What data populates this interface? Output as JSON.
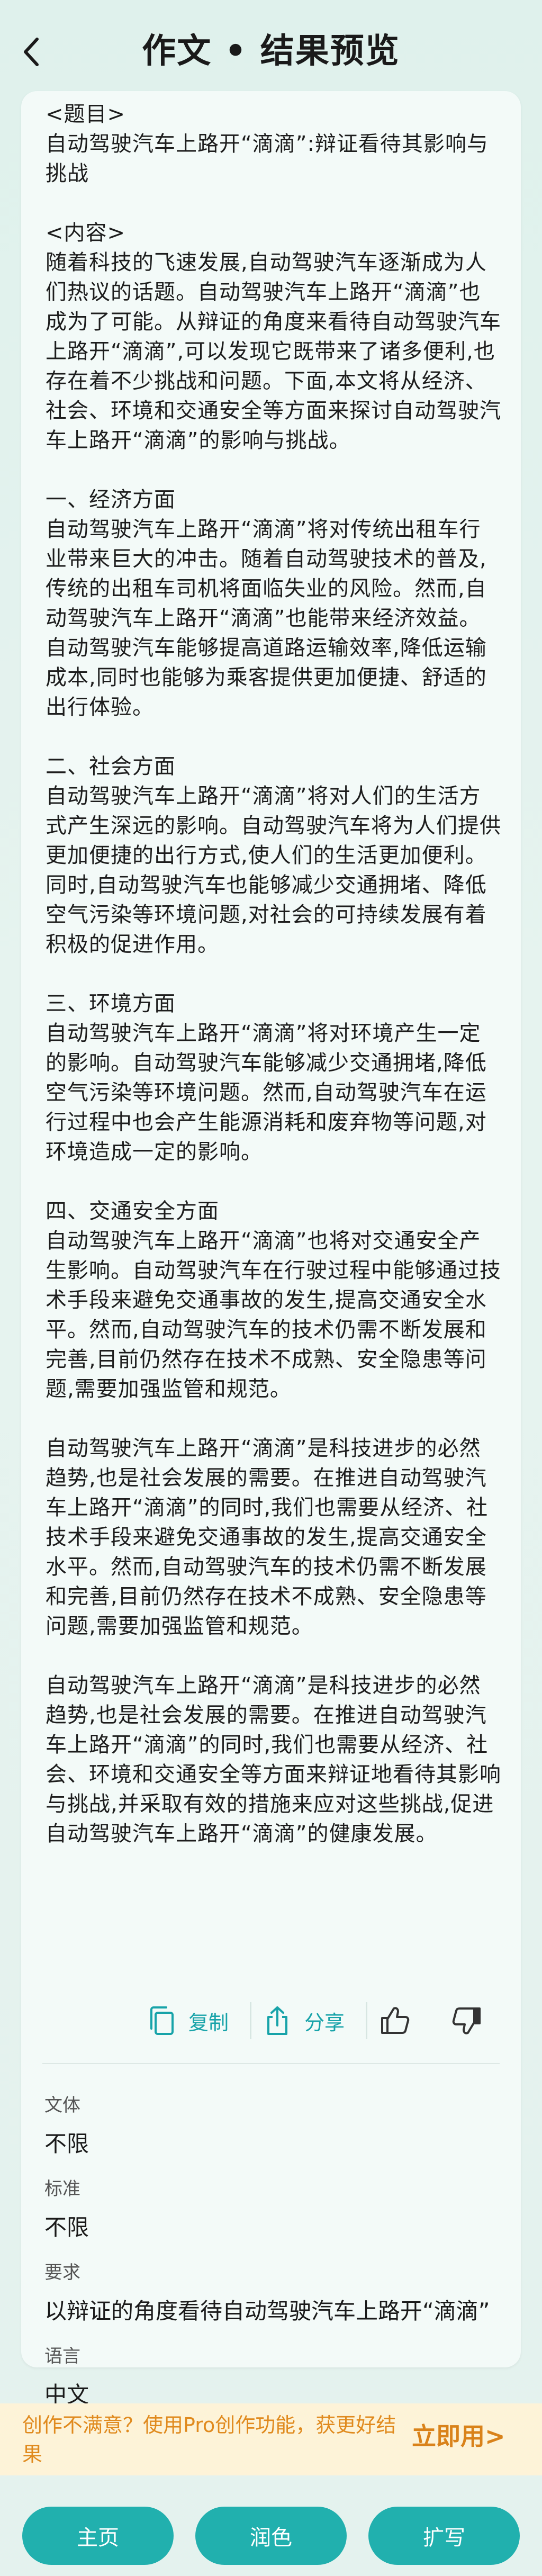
{
  "header": {
    "title": "作文 • 结果预览"
  },
  "essay": {
    "text": "<题目>\n自动驾驶汽车上路开“滴滴”:辩证看待其影响与挑战\n\n<内容>\n随着科技的飞速发展,自动驾驶汽车逐渐成为人们热议的话题。自动驾驶汽车上路开“滴滴”也成为了可能。从辩证的角度来看待自动驾驶汽车上路开“滴滴”,可以发现它既带来了诸多便利,也存在着不少挑战和问题。下面,本文将从经济、社会、环境和交通安全等方面来探讨自动驾驶汽车上路开“滴滴”的影响与挑战。\n\n一、经济方面\n自动驾驶汽车上路开“滴滴”将对传统出租车行业带来巨大的冲击。随着自动驾驶技术的普及,传统的出租车司机将面临失业的风险。然而,自动驾驶汽车上路开“滴滴”也能带来经济效益。自动驾驶汽车能够提高道路运输效率,降低运输成本,同时也能够为乘客提供更加便捷、舒适的出行体验。\n\n二、社会方面\n自动驾驶汽车上路开“滴滴”将对人们的生活方式产生深远的影响。自动驾驶汽车将为人们提供更加便捷的出行方式,使人们的生活更加便利。同时,自动驾驶汽车也能够减少交通拥堵、降低空气污染等环境问题,对社会的可持续发展有着积极的促进作用。\n\n三、环境方面\n自动驾驶汽车上路开“滴滴”将对环境产生一定的影响。自动驾驶汽车能够减少交通拥堵,降低空气污染等环境问题。然而,自动驾驶汽车在运行过程中也会产生能源消耗和废弃物等问题,对环境造成一定的影响。\n\n四、交通安全方面\n自动驾驶汽车上路开“滴滴”也将对交通安全产生影响。自动驾驶汽车在行驶过程中能够通过技术手段来避免交通事故的发生,提高交通安全水平。然而,自动驾驶汽车的技术仍需不断发展和完善,目前仍然存在技术不成熟、安全隐患等问题,需要加强监管和规范。\n\n自动驾驶汽车上路开“滴滴”是科技进步的必然趋势,也是社会发展的需要。在推进自动驾驶汽车上路开“滴滴”的同时,我们也需要从经济、社技术手段来避免交通事故的发生,提高交通安全水平。然而,自动驾驶汽车的技术仍需不断发展和完善,目前仍然存在技术不成熟、安全隐患等问题,需要加强监管和规范。\n\n自动驾驶汽车上路开“滴滴”是科技进步的必然趋势,也是社会发展的需要。在推进自动驾驶汽车上路开“滴滴”的同时,我们也需要从经济、社会、环境和交通安全等方面来辩证地看待其影响与挑战,并采取有效的措施来应对这些挑战,促进自动驾驶汽车上路开“滴滴”的健康发展。"
  },
  "actions": {
    "copy_label": "复制",
    "share_label": "分享"
  },
  "meta": {
    "style_label": "文体",
    "style_value": "不限",
    "standard_label": "标准",
    "standard_value": "不限",
    "requirement_label": "要求",
    "requirement_value": "以辩证的角度看待自动驾驶汽车上路开“滴滴”",
    "language_label": "语言",
    "language_value": "中文"
  },
  "promo": {
    "text": "创作不满意？使用Pro创作功能，获更好结果",
    "link_label": "立即用>"
  },
  "bottom_bar": {
    "home_label": "主页",
    "polish_label": "润色",
    "expand_label": "扩写"
  },
  "colors": {
    "accent": "#21b0ae",
    "link": "#17a3a9",
    "promo_bg": "#fdf3d8",
    "promo_text": "#e08a1e"
  }
}
